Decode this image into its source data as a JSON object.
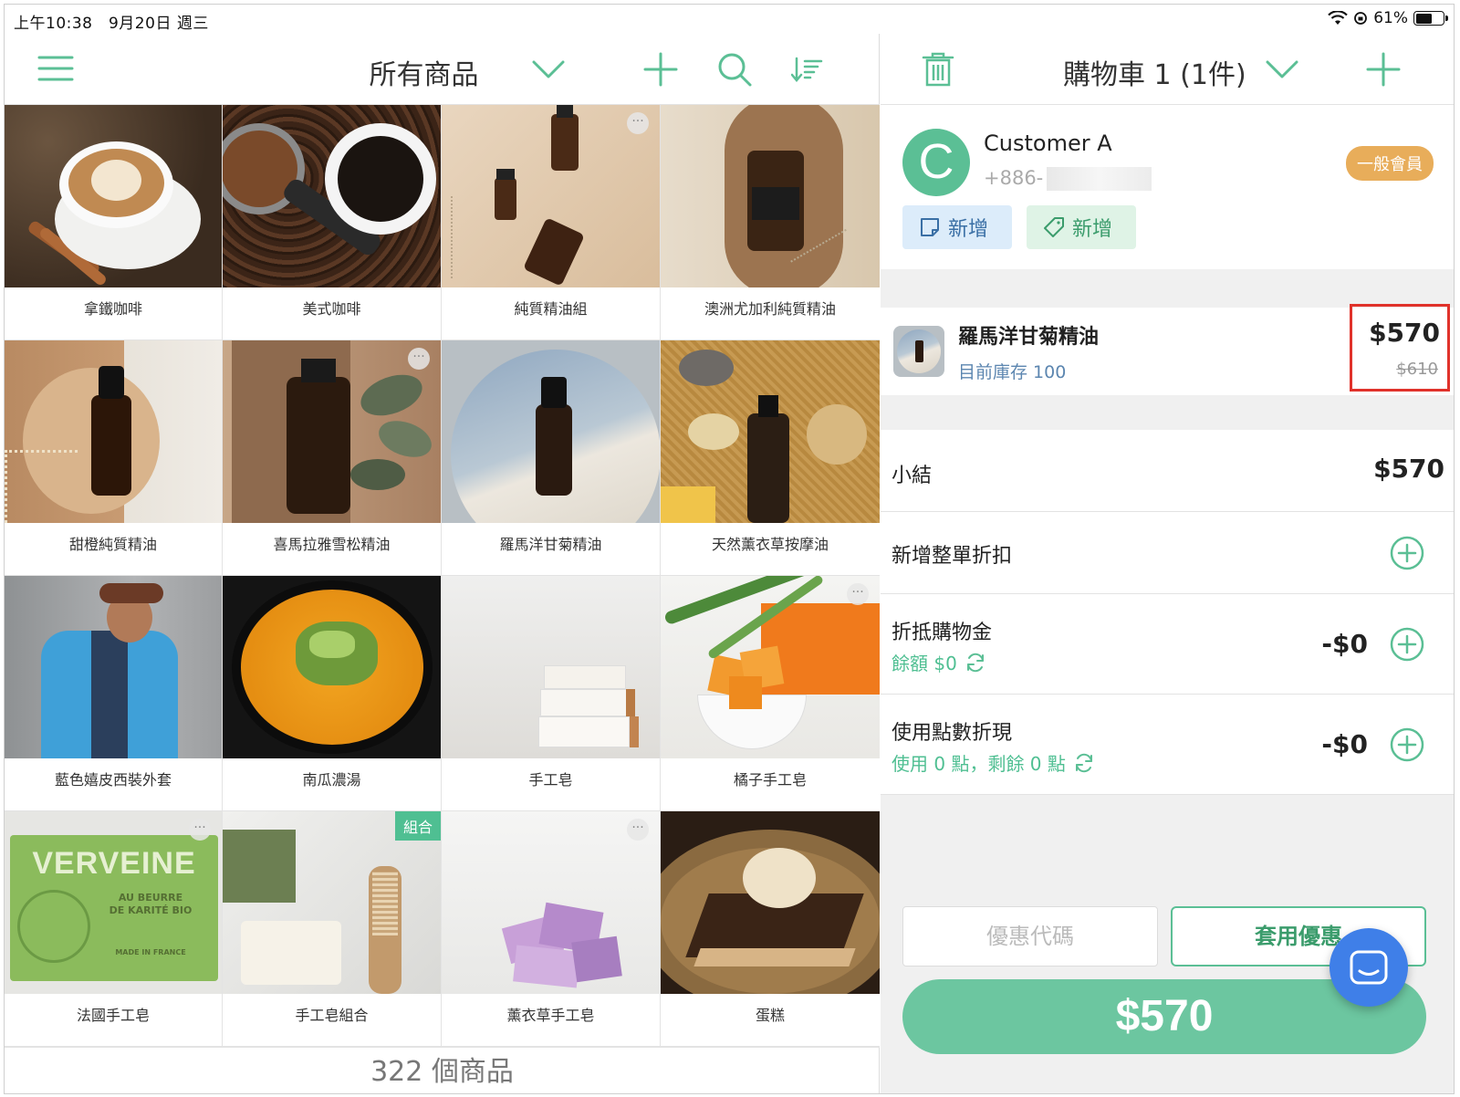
{
  "status": {
    "time": "上午10:38　9月20日 週三",
    "battery": "61%"
  },
  "products": {
    "title": "所有商品",
    "footer": "322 個商品",
    "items": [
      {
        "name": "拿鐵咖啡"
      },
      {
        "name": "美式咖啡"
      },
      {
        "name": "純質精油組"
      },
      {
        "name": "澳洲尤加利純質精油"
      },
      {
        "name": "甜橙純質精油"
      },
      {
        "name": "喜馬拉雅雪松精油"
      },
      {
        "name": "羅馬洋甘菊精油"
      },
      {
        "name": "天然薰衣草按摩油"
      },
      {
        "name": "藍色嬉皮西裝外套"
      },
      {
        "name": "南瓜濃湯"
      },
      {
        "name": "手工皂"
      },
      {
        "name": "橘子手工皂"
      },
      {
        "name": "法國手工皂"
      },
      {
        "name": "手工皂組合",
        "badge": "組合"
      },
      {
        "name": "薰衣草手工皂"
      },
      {
        "name": "蛋糕"
      }
    ],
    "soap_print": {
      "line1": "VERVEINE",
      "line2": "AU BEURRE",
      "line3": "DE KARITÉ BIO",
      "line4": "MADE IN FRANCE"
    }
  },
  "cart": {
    "title": "購物車 1 (1件)",
    "customer": {
      "initial": "C",
      "name": "Customer A",
      "phone": "+886-",
      "level": "一般會員",
      "note_label": "新增",
      "tag_label": "新增"
    },
    "item": {
      "name": "羅馬洋甘菊精油",
      "stock": "目前庫存 100",
      "price": "$570",
      "original_price": "$610"
    },
    "subtotal": {
      "label": "小結",
      "value": "$570"
    },
    "order_discount": {
      "label": "新增整單折扣"
    },
    "credit": {
      "label": "折抵購物金",
      "sub": "餘額 $0",
      "value": "-$0"
    },
    "points": {
      "label": "使用點數折現",
      "sub": "使用 0 點，剩餘 0 點",
      "value": "-$0"
    },
    "coupon_placeholder": "優惠代碼",
    "coupon_apply": "套用優惠",
    "pay_total": "$570"
  },
  "colors": {
    "accent": "#5bbf95",
    "highlight": "#e0322b",
    "member": "#e8ad5a",
    "chat": "#3f7fe8"
  }
}
